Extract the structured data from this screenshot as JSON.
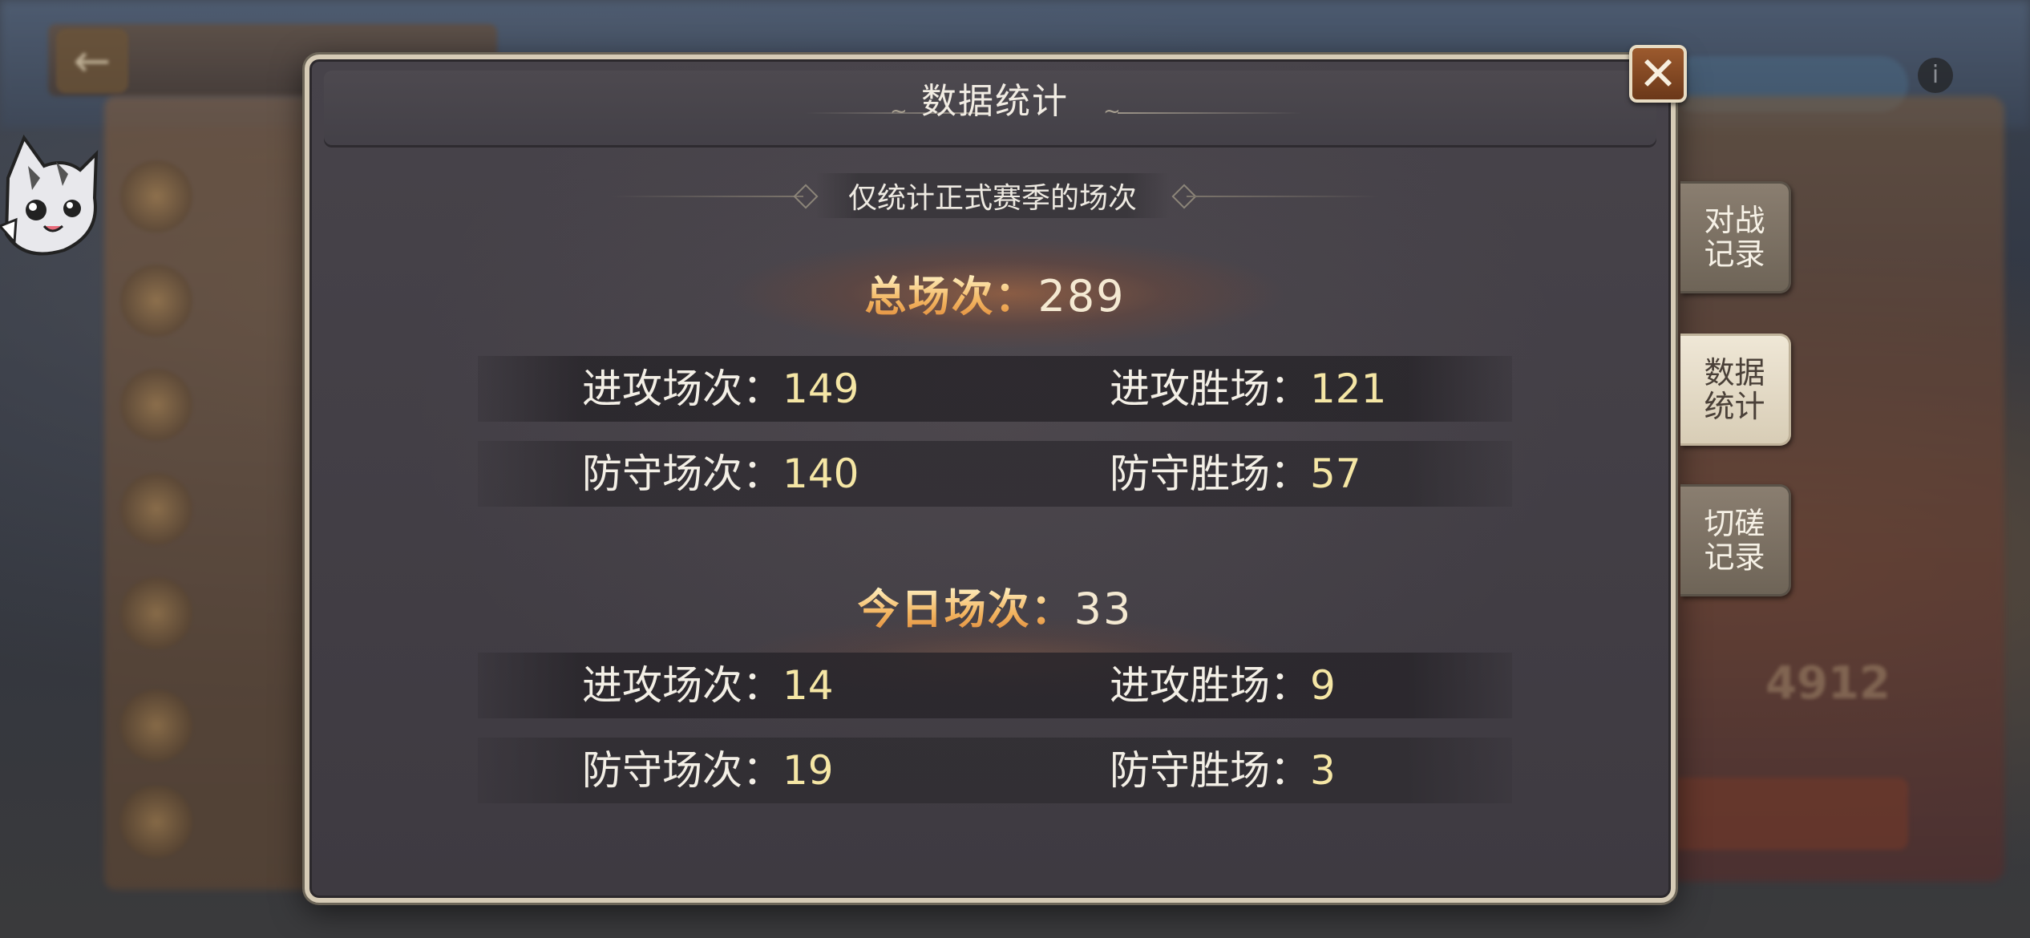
{
  "modal": {
    "title": "数据统计",
    "subtitle": "仅统计正式赛季的场次",
    "close_label": "✕"
  },
  "total": {
    "label": "总场次：",
    "value": "289",
    "attack_count_label": "进攻场次：",
    "attack_count": "149",
    "attack_wins_label": "进攻胜场：",
    "attack_wins": "121",
    "defense_count_label": "防守场次：",
    "defense_count": "140",
    "defense_wins_label": "防守胜场：",
    "defense_wins": "57"
  },
  "today": {
    "label": "今日场次：",
    "value": "33",
    "attack_count_label": "进攻场次：",
    "attack_count": "14",
    "attack_wins_label": "进攻胜场：",
    "attack_wins": "9",
    "defense_count_label": "防守场次：",
    "defense_count": "19",
    "defense_wins_label": "防守胜场：",
    "defense_wins": "3"
  },
  "side_tabs": [
    {
      "label": "对战记录",
      "active": false
    },
    {
      "label": "数据统计",
      "active": true
    },
    {
      "label": "切磋记录",
      "active": false
    }
  ],
  "background": {
    "back_icon": "←",
    "score": "4912",
    "info_icon": "i"
  },
  "colors": {
    "panel": "#433f46",
    "panel_border": "#d6cbb6",
    "title_gold": "#f3b662",
    "value_yellow": "#f5e6a5",
    "close_button": "#8a4a24",
    "tab_active": "#e6ddc9",
    "tab_inactive": "#7c7164"
  }
}
